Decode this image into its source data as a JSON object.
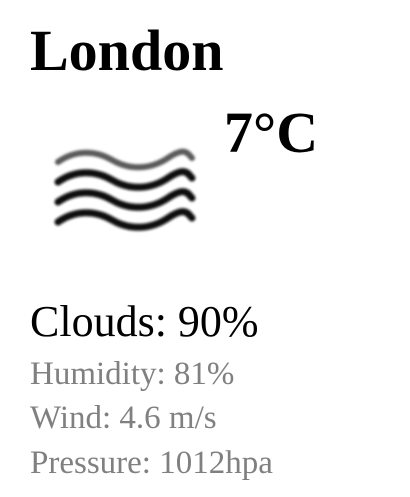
{
  "weather": {
    "city": "London",
    "temperature": "7°C",
    "icon": "mist-icon",
    "clouds": "Clouds: 90%",
    "humidity": "Humidity: 81%",
    "wind": "Wind: 4.6 m/s",
    "pressure": "Pressure: 1012hpa"
  }
}
